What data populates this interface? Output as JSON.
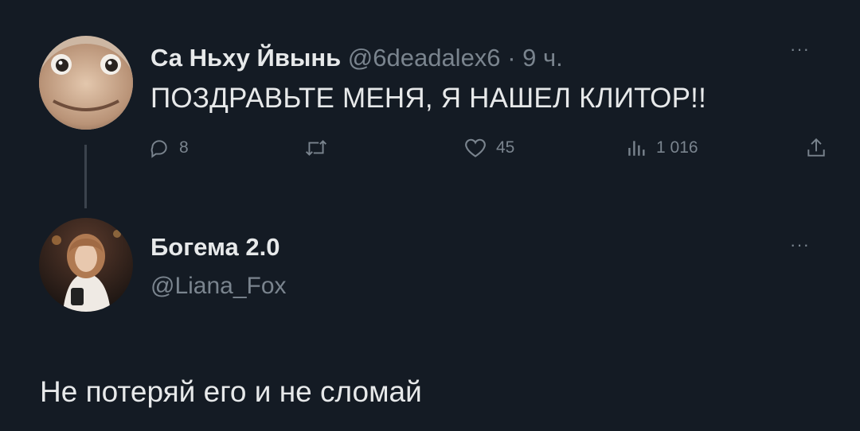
{
  "tweet": {
    "author": {
      "display_name": "Са Ньху Йвынь",
      "handle": "@6deadalex6",
      "separator": "·",
      "time": "9 ч."
    },
    "text": "ПОЗДРАВЬТЕ МЕНЯ, Я НАШЕЛ КЛИТОР!!",
    "more_label": "···",
    "actions": {
      "reply_count": "8",
      "retweet_count": "",
      "like_count": "45",
      "view_count": "1 016"
    }
  },
  "reply": {
    "author": {
      "display_name": "Богема 2.0",
      "handle": "@Liana_Fox"
    },
    "more_label": "···",
    "text": "Не потеряй его и не сломай"
  },
  "icons": {
    "reply": "reply-bubble-icon",
    "retweet": "retweet-icon",
    "like": "heart-icon",
    "views": "views-bars-icon",
    "share": "share-icon",
    "more": "more-dots-icon"
  },
  "colors": {
    "background": "#141b24",
    "text": "#e7e9ea",
    "muted": "#7a848e"
  }
}
